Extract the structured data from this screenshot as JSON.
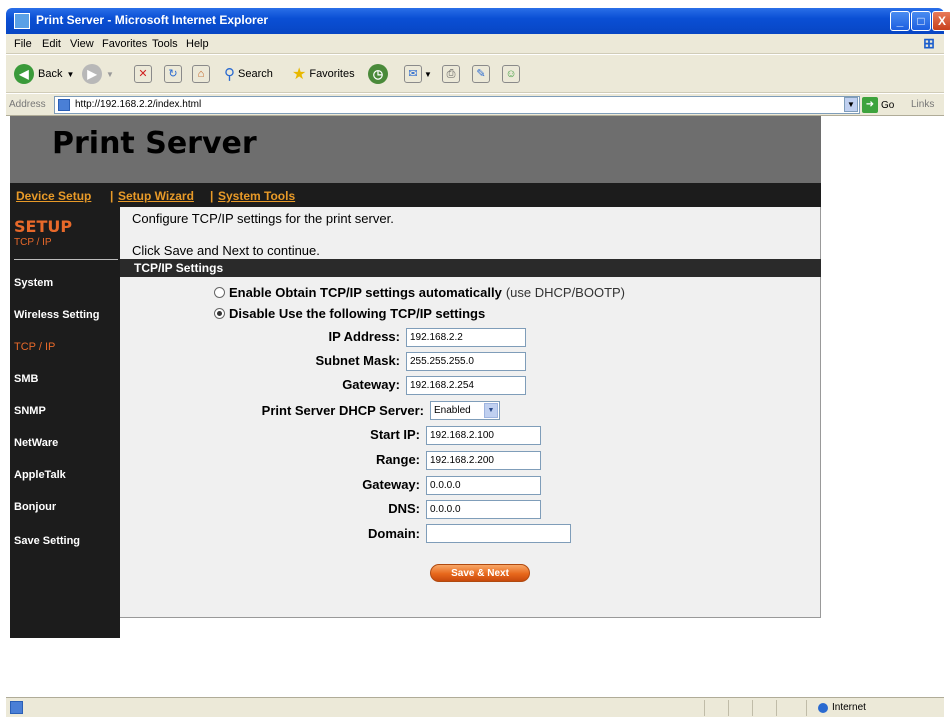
{
  "window": {
    "title": "Print Server - Microsoft Internet Explorer",
    "min": "_",
    "max": "□",
    "close": "X"
  },
  "menu": [
    "File",
    "Edit",
    "View",
    "Favorites",
    "Tools",
    "Help"
  ],
  "toolbar": {
    "back": "Back",
    "search": "Search",
    "favorites": "Favorites"
  },
  "address": {
    "label": "Address",
    "url": "http://192.168.2.2/index.html",
    "go": "Go",
    "links": "Links"
  },
  "page": {
    "title": "Print Server",
    "nav": [
      "Device Setup",
      "Setup Wizard",
      "System Tools"
    ],
    "nav_sep": "|",
    "section": "SETUP",
    "subsection": "TCP / IP",
    "sidebar": [
      "System",
      "Wireless Setting",
      "TCP / IP",
      "SMB",
      "SNMP",
      "NetWare",
      "AppleTalk",
      "Bonjour",
      "Save Setting"
    ],
    "intro1": "Configure TCP/IP settings for the print server.",
    "intro2": "Click Save and Next to continue.",
    "settings_title": "TCP/IP Settings",
    "radio_auto": "Enable Obtain TCP/IP settings automatically",
    "radio_auto_note": "(use DHCP/BOOTP)",
    "radio_manual": "Disable Use the following TCP/IP settings",
    "ip_label": "IP Address:",
    "ip_value": "192.168.2.2",
    "mask_label": "Subnet Mask:",
    "mask_value": "255.255.255.0",
    "gw_label": "Gateway:",
    "gw_value": "192.168.2.254",
    "dhcp_label": "Print Server DHCP Server:",
    "dhcp_value": "Enabled",
    "start_label": "Start IP:",
    "start_value": "192.168.2.100",
    "range_label": "Range:",
    "range_value": "192.168.2.200",
    "gw2_label": "Gateway:",
    "gw2_value": "0.0.0.0",
    "dns_label": "DNS:",
    "dns_value": "0.0.0.0",
    "domain_label": "Domain:",
    "domain_value": "",
    "save_button": "Save & Next"
  },
  "status": {
    "zone": "Internet"
  }
}
